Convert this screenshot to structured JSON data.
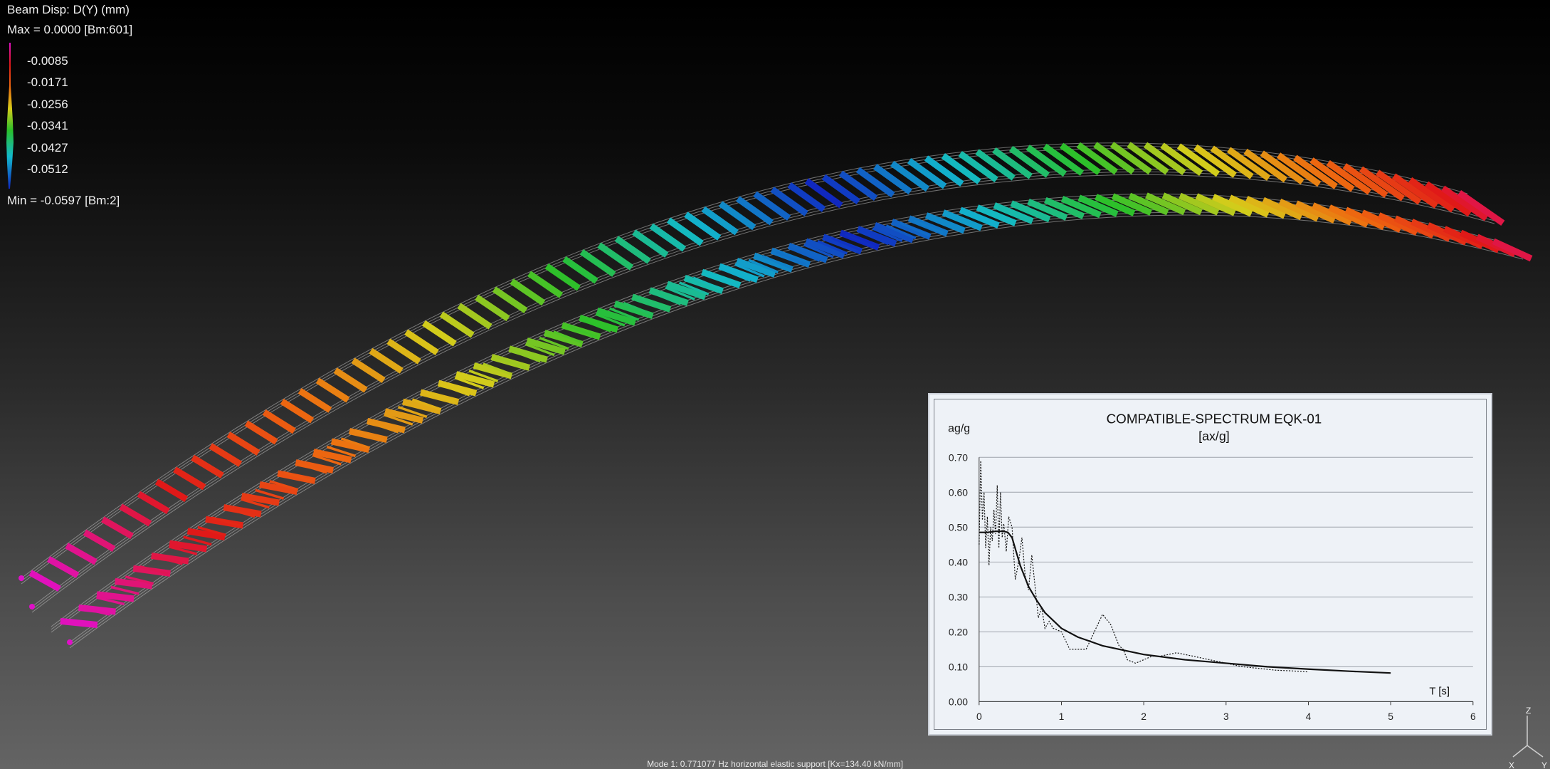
{
  "legend": {
    "title": "Beam Disp: D(Y) (mm)",
    "max_label": "Max = 0.0000 [Bm:601]",
    "min_label": "Min = -0.0597 [Bm:2]",
    "ticks": [
      "-0.0085",
      "-0.0171",
      "-0.0256",
      "-0.0341",
      "-0.0427",
      "-0.0512"
    ]
  },
  "viewport": {
    "colors": {
      "magenta": "#e010c8",
      "red": "#e01818",
      "orange": "#ee6a10",
      "yellow": "#d8cc1a",
      "green": "#2ac02a",
      "cyan": "#12b8cc",
      "blue": "#1028c0"
    }
  },
  "status_bar": {
    "text": "Mode 1: 0.771077 Hz  horizontal elastic support [Kx=134.40 kN/mm]"
  },
  "axis_triad": {
    "z": "Z",
    "x": "X",
    "y": "Y"
  },
  "chart_data": {
    "type": "line",
    "title": "COMPATIBLE-SPECTRUM EQK-01",
    "subtitle": "[ax/g]",
    "ylabel": "ag/g",
    "xlabel": "T [s]",
    "xlim": [
      0,
      6
    ],
    "ylim": [
      0,
      0.7
    ],
    "xticks": [
      "0",
      "1",
      "2",
      "3",
      "4",
      "5",
      "6"
    ],
    "yticks": [
      "0.00",
      "0.10",
      "0.20",
      "0.30",
      "0.40",
      "0.50",
      "0.60",
      "0.70"
    ],
    "grid": "horizontal",
    "series": [
      {
        "style": "solid",
        "x": [
          0.0,
          0.1,
          0.2,
          0.3,
          0.35,
          0.4,
          0.45,
          0.5,
          0.6,
          0.7,
          0.8,
          1.0,
          1.2,
          1.5,
          2.0,
          2.5,
          3.0,
          3.5,
          4.0,
          4.5,
          5.0
        ],
        "y": [
          0.485,
          0.485,
          0.488,
          0.488,
          0.485,
          0.47,
          0.43,
          0.39,
          0.33,
          0.29,
          0.255,
          0.21,
          0.185,
          0.16,
          0.135,
          0.12,
          0.11,
          0.1,
          0.093,
          0.087,
          0.082
        ]
      },
      {
        "style": "dotted",
        "x": [
          0.0,
          0.02,
          0.04,
          0.06,
          0.08,
          0.1,
          0.12,
          0.14,
          0.16,
          0.18,
          0.2,
          0.22,
          0.24,
          0.26,
          0.28,
          0.3,
          0.33,
          0.36,
          0.4,
          0.44,
          0.48,
          0.52,
          0.56,
          0.6,
          0.64,
          0.68,
          0.72,
          0.76,
          0.8,
          0.85,
          0.9,
          1.0,
          1.1,
          1.2,
          1.3,
          1.4,
          1.5,
          1.6,
          1.7,
          1.75,
          1.8,
          1.9,
          2.0,
          2.1,
          2.2,
          2.4,
          2.6,
          2.8,
          3.0,
          3.2,
          3.4,
          3.6,
          3.8,
          4.0
        ],
        "y": [
          0.45,
          0.69,
          0.52,
          0.6,
          0.44,
          0.53,
          0.39,
          0.5,
          0.46,
          0.55,
          0.48,
          0.62,
          0.44,
          0.6,
          0.47,
          0.51,
          0.43,
          0.53,
          0.5,
          0.35,
          0.4,
          0.47,
          0.36,
          0.32,
          0.42,
          0.33,
          0.24,
          0.27,
          0.21,
          0.23,
          0.21,
          0.2,
          0.15,
          0.15,
          0.15,
          0.2,
          0.25,
          0.22,
          0.16,
          0.15,
          0.12,
          0.11,
          0.12,
          0.13,
          0.13,
          0.14,
          0.13,
          0.12,
          0.11,
          0.1,
          0.095,
          0.09,
          0.088,
          0.085
        ]
      }
    ]
  }
}
